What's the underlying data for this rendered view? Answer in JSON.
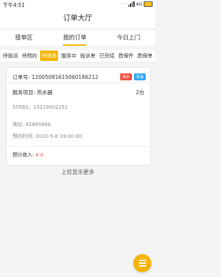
{
  "status_bar": {
    "time": "下午4:51",
    "network": "4G",
    "battery_level": "72"
  },
  "header": {
    "title": "订单大厅"
  },
  "tabs": [
    {
      "label": "接单区",
      "active": false
    },
    {
      "label": "我的订单",
      "active": true
    },
    {
      "label": "今日上门",
      "active": false
    }
  ],
  "sub_tabs": [
    {
      "label": "待指派",
      "active": false
    },
    {
      "label": "待预约",
      "active": false
    },
    {
      "label": "待服务",
      "active": true
    },
    {
      "label": "服务中",
      "active": false
    },
    {
      "label": "投诉单",
      "active": false
    },
    {
      "label": "已完结",
      "active": false
    },
    {
      "label": "质保件",
      "active": false
    },
    {
      "label": "质保单",
      "active": false
    }
  ],
  "order": {
    "order_no_label": "订单号:",
    "order_no": "120050816150601862​12",
    "badge_warranty": "保外",
    "badge_install": "安装",
    "service_label": "服务项目:",
    "service": "热水器",
    "quantity": "2台",
    "phones": "55583，13219002251",
    "address_label": "地址:",
    "address": "82885666",
    "appointment_label": "预约时间:",
    "appointment": "2020-5-8 19:00:00",
    "income_label": "预计收入:",
    "income_currency": "¥",
    "income_amount": "0"
  },
  "footer": {
    "load_more": "上拉显示更多"
  },
  "colors": {
    "accent": "#f6b400",
    "badge_red": "#f24b3c",
    "badge_blue": "#32a7f0"
  },
  "fab_icon": "menu-icon"
}
